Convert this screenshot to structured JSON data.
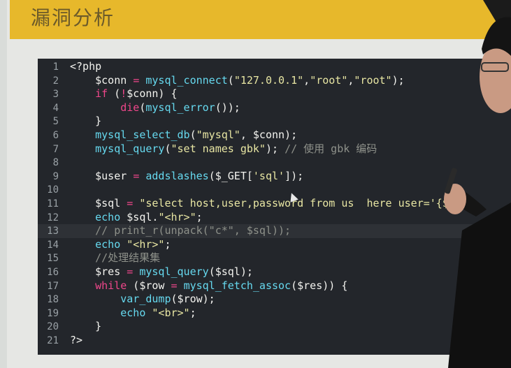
{
  "slide": {
    "title": "漏洞分析"
  },
  "editor": {
    "highlighted_line": 13,
    "lines": [
      {
        "n": "1",
        "tokens": [
          {
            "t": "<?php",
            "c": "default"
          }
        ]
      },
      {
        "n": "2",
        "tokens": [
          {
            "t": "    $conn ",
            "c": "default"
          },
          {
            "t": "=",
            "c": "op"
          },
          {
            "t": " ",
            "c": "default"
          },
          {
            "t": "mysql_connect",
            "c": "func"
          },
          {
            "t": "(",
            "c": "default"
          },
          {
            "t": "\"127.0.0.1\"",
            "c": "string"
          },
          {
            "t": ",",
            "c": "default"
          },
          {
            "t": "\"root\"",
            "c": "string"
          },
          {
            "t": ",",
            "c": "default"
          },
          {
            "t": "\"root\"",
            "c": "string"
          },
          {
            "t": ");",
            "c": "default"
          }
        ]
      },
      {
        "n": "3",
        "tokens": [
          {
            "t": "    ",
            "c": "default"
          },
          {
            "t": "if",
            "c": "keyword"
          },
          {
            "t": " (",
            "c": "default"
          },
          {
            "t": "!",
            "c": "op"
          },
          {
            "t": "$conn) {",
            "c": "default"
          }
        ]
      },
      {
        "n": "4",
        "tokens": [
          {
            "t": "        ",
            "c": "default"
          },
          {
            "t": "die",
            "c": "keyword"
          },
          {
            "t": "(",
            "c": "default"
          },
          {
            "t": "mysql_error",
            "c": "func"
          },
          {
            "t": "());",
            "c": "default"
          }
        ]
      },
      {
        "n": "5",
        "tokens": [
          {
            "t": "    }",
            "c": "default"
          }
        ]
      },
      {
        "n": "6",
        "tokens": [
          {
            "t": "    ",
            "c": "default"
          },
          {
            "t": "mysql_select_db",
            "c": "func"
          },
          {
            "t": "(",
            "c": "default"
          },
          {
            "t": "\"mysql\"",
            "c": "string"
          },
          {
            "t": ", $conn);",
            "c": "default"
          }
        ]
      },
      {
        "n": "7",
        "tokens": [
          {
            "t": "    ",
            "c": "default"
          },
          {
            "t": "mysql_query",
            "c": "func"
          },
          {
            "t": "(",
            "c": "default"
          },
          {
            "t": "\"set names gbk\"",
            "c": "string"
          },
          {
            "t": "); ",
            "c": "default"
          },
          {
            "t": "// 使用 gbk 编码",
            "c": "comment"
          }
        ]
      },
      {
        "n": "8",
        "tokens": []
      },
      {
        "n": "9",
        "tokens": [
          {
            "t": "    $user ",
            "c": "default"
          },
          {
            "t": "=",
            "c": "op"
          },
          {
            "t": " ",
            "c": "default"
          },
          {
            "t": "addslashes",
            "c": "func"
          },
          {
            "t": "($_GET[",
            "c": "default"
          },
          {
            "t": "'sql'",
            "c": "string"
          },
          {
            "t": "]);",
            "c": "default"
          }
        ]
      },
      {
        "n": "10",
        "tokens": []
      },
      {
        "n": "11",
        "tokens": [
          {
            "t": "    $sql ",
            "c": "default"
          },
          {
            "t": "=",
            "c": "op"
          },
          {
            "t": " ",
            "c": "default"
          },
          {
            "t": "\"select host,user,password from us  here user='{$u",
            "c": "string"
          }
        ]
      },
      {
        "n": "12",
        "tokens": [
          {
            "t": "    ",
            "c": "default"
          },
          {
            "t": "echo",
            "c": "func"
          },
          {
            "t": " $sql.",
            "c": "default"
          },
          {
            "t": "\"<hr>\"",
            "c": "string"
          },
          {
            "t": ";",
            "c": "default"
          }
        ]
      },
      {
        "n": "13",
        "tokens": [
          {
            "t": "    // print_r(unpack(\"c*\", $sql));",
            "c": "comment"
          }
        ]
      },
      {
        "n": "14",
        "tokens": [
          {
            "t": "    ",
            "c": "default"
          },
          {
            "t": "echo",
            "c": "func"
          },
          {
            "t": " ",
            "c": "default"
          },
          {
            "t": "\"<hr>\"",
            "c": "string"
          },
          {
            "t": ";",
            "c": "default"
          }
        ]
      },
      {
        "n": "15",
        "tokens": [
          {
            "t": "    //处理结果集",
            "c": "comment"
          }
        ]
      },
      {
        "n": "16",
        "tokens": [
          {
            "t": "    $res ",
            "c": "default"
          },
          {
            "t": "=",
            "c": "op"
          },
          {
            "t": " ",
            "c": "default"
          },
          {
            "t": "mysql_query",
            "c": "func"
          },
          {
            "t": "($sql);",
            "c": "default"
          }
        ]
      },
      {
        "n": "17",
        "tokens": [
          {
            "t": "    ",
            "c": "default"
          },
          {
            "t": "while",
            "c": "keyword"
          },
          {
            "t": " ($row ",
            "c": "default"
          },
          {
            "t": "=",
            "c": "op"
          },
          {
            "t": " ",
            "c": "default"
          },
          {
            "t": "mysql_fetch_assoc",
            "c": "func"
          },
          {
            "t": "($res)) {",
            "c": "default"
          }
        ]
      },
      {
        "n": "18",
        "tokens": [
          {
            "t": "        ",
            "c": "default"
          },
          {
            "t": "var_dump",
            "c": "func"
          },
          {
            "t": "($row);",
            "c": "default"
          }
        ]
      },
      {
        "n": "19",
        "tokens": [
          {
            "t": "        ",
            "c": "default"
          },
          {
            "t": "echo",
            "c": "func"
          },
          {
            "t": " ",
            "c": "default"
          },
          {
            "t": "\"<br>\"",
            "c": "string"
          },
          {
            "t": ";",
            "c": "default"
          }
        ]
      },
      {
        "n": "20",
        "tokens": [
          {
            "t": "    }",
            "c": "default"
          }
        ]
      },
      {
        "n": "21",
        "tokens": [
          {
            "t": "?>",
            "c": "default"
          }
        ]
      }
    ]
  }
}
